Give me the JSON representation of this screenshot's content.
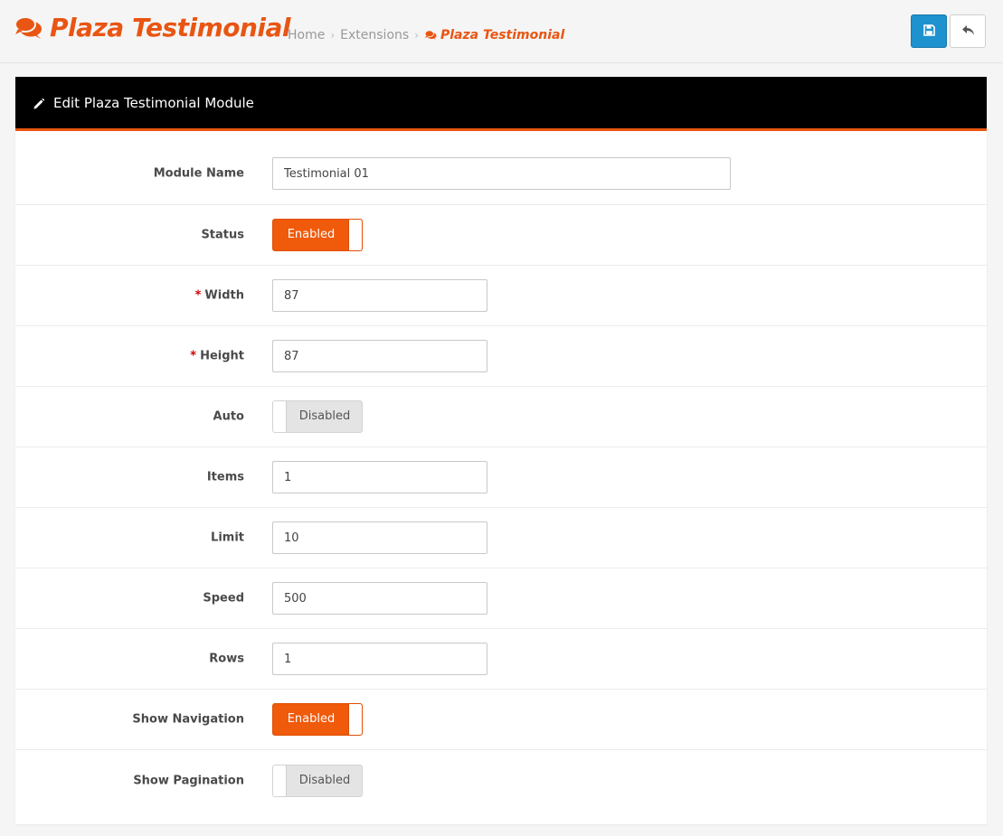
{
  "header": {
    "title": "Plaza Testimonial",
    "title_icon": "comments-icon",
    "breadcrumb": [
      {
        "label": "Home"
      },
      {
        "label": "Extensions"
      },
      {
        "label": "Plaza Testimonial",
        "icon": "comments-icon",
        "active": true
      }
    ],
    "actions": {
      "save_icon": "save-icon",
      "back_icon": "reply-icon"
    }
  },
  "panel": {
    "title": "Edit Plaza Testimonial Module",
    "title_icon": "pencil-icon"
  },
  "form": {
    "module_name": {
      "label": "Module Name",
      "value": "Testimonial 01"
    },
    "status": {
      "label": "Status",
      "value": "Enabled",
      "enabled": true
    },
    "width": {
      "label": "Width",
      "required_mark": "*",
      "value": "87"
    },
    "height": {
      "label": "Height",
      "required_mark": "*",
      "value": "87"
    },
    "auto": {
      "label": "Auto",
      "value": "Disabled",
      "enabled": false
    },
    "items": {
      "label": "Items",
      "value": "1"
    },
    "limit": {
      "label": "Limit",
      "value": "10"
    },
    "speed": {
      "label": "Speed",
      "value": "500"
    },
    "rows": {
      "label": "Rows",
      "value": "1"
    },
    "show_navigation": {
      "label": "Show Navigation",
      "value": "Enabled",
      "enabled": true
    },
    "show_pagination": {
      "label": "Show Pagination",
      "value": "Disabled",
      "enabled": false
    }
  },
  "colors": {
    "accent": "#e95512",
    "toggle_on": "#f05a0b",
    "primary_button": "#1e91cf",
    "panel_heading_bg": "#000000",
    "required": "#d00000"
  }
}
